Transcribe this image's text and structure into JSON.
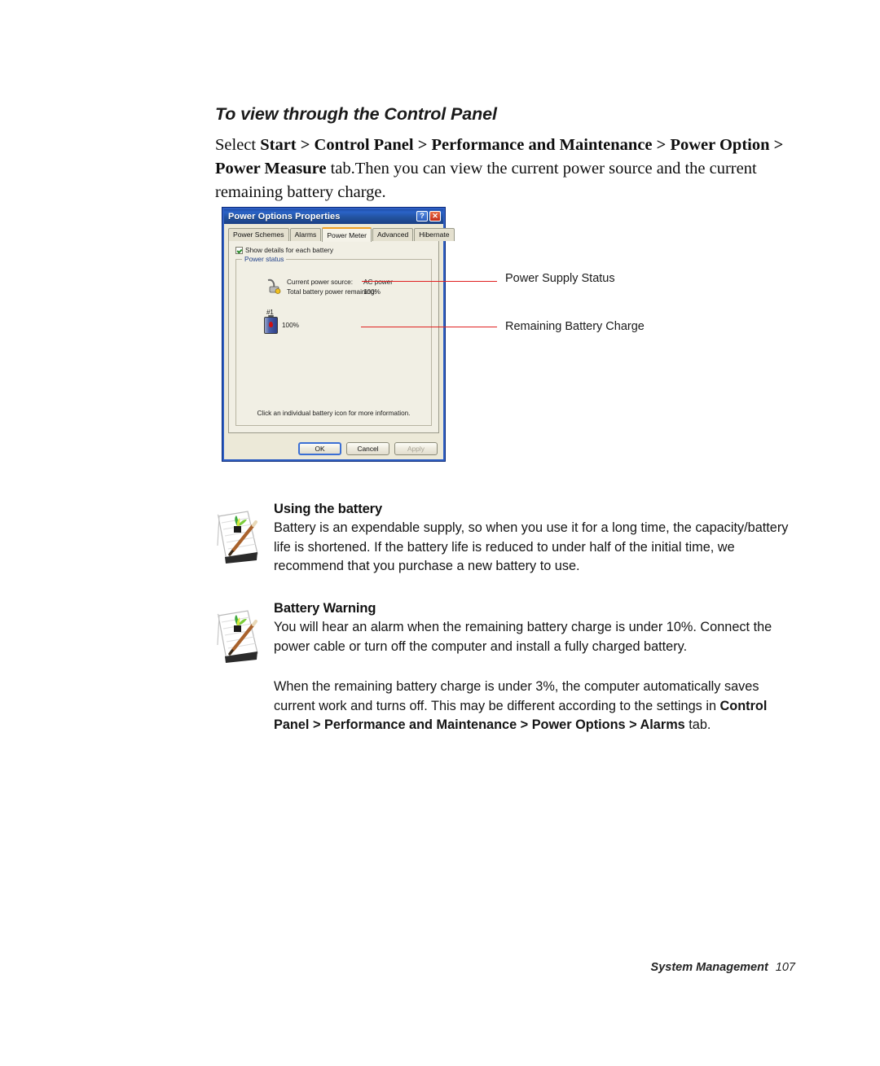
{
  "page": {
    "heading": "To view through the Control Panel",
    "intro_parts": {
      "p1": "Select ",
      "b1": "Start > Control Panel > Performance and Maintenance > Power Option > Power Measure",
      "p2": " tab.Then you can view the current power source and the current remaining battery charge."
    }
  },
  "dialog": {
    "title": "Power Options Properties",
    "help_button": "?",
    "close_button": "✕",
    "tabs": [
      {
        "label": "Power Schemes",
        "active": false
      },
      {
        "label": "Alarms",
        "active": false
      },
      {
        "label": "Power Meter",
        "active": true
      },
      {
        "label": "Advanced",
        "active": false
      },
      {
        "label": "Hibernate",
        "active": false
      }
    ],
    "checkbox": {
      "label": "Show details for each battery",
      "checked": true
    },
    "group": {
      "title": "Power status",
      "rows": [
        {
          "key": "Current power source:",
          "value": "AC power"
        },
        {
          "key": "Total battery power remaining:",
          "value": "100%"
        }
      ]
    },
    "battery": {
      "number": "#1",
      "percent": "100%"
    },
    "hint": "Click an individual battery icon for more information.",
    "buttons": [
      {
        "label": "OK",
        "state": "default"
      },
      {
        "label": "Cancel",
        "state": "normal"
      },
      {
        "label": "Apply",
        "state": "disabled"
      }
    ]
  },
  "callouts": {
    "line_color": "#e02020",
    "items": [
      {
        "label": "Power Supply Status"
      },
      {
        "label": "Remaining Battery Charge"
      }
    ]
  },
  "notes": [
    {
      "title": "Using the battery",
      "text": "Battery is an expendable supply, so when you use it for a long time, the capacity/battery life is shortened. If the battery life is reduced to under half of the initial time, we recommend that you purchase a new battery to use."
    },
    {
      "title": "Battery Warning",
      "text": "You will hear an alarm when the remaining battery charge is under 10%. Connect the power cable or turn off the computer and install a fully charged battery."
    }
  ],
  "extra_paragraph": {
    "p1": "When the remaining battery charge is under 3%, the computer automatically saves current work and turns off. This may be different according to the settings in ",
    "b1": "Control Panel > Performance and Maintenance > Power Options > Alarms",
    "p2": " tab."
  },
  "footer": {
    "section": "System Management",
    "page_number": "107"
  }
}
